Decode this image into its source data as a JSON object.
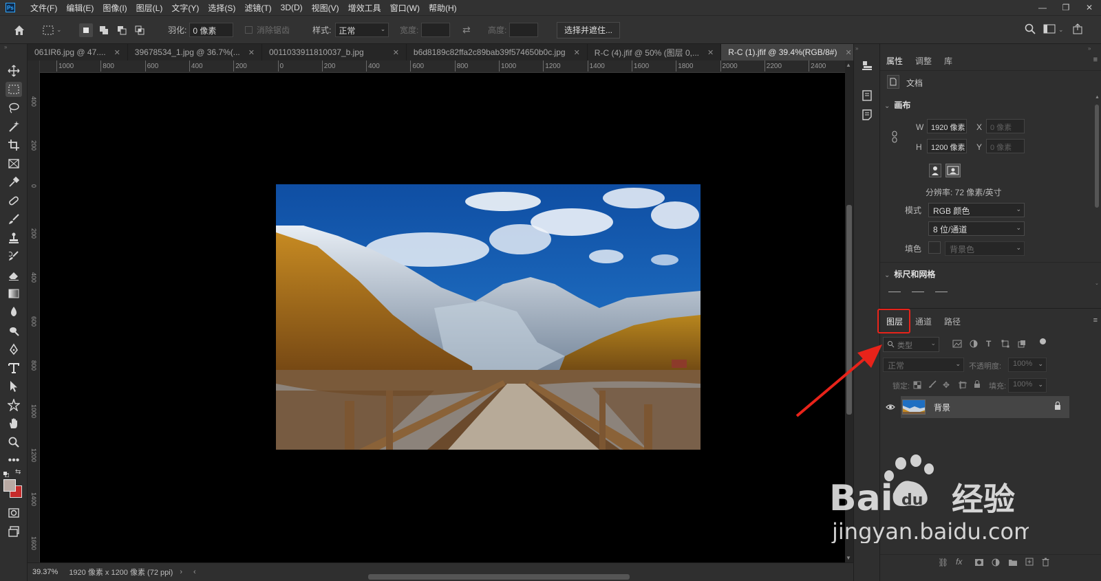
{
  "app": {
    "logo_text": "Ps",
    "menu": [
      "文件(F)",
      "编辑(E)",
      "图像(I)",
      "图层(L)",
      "文字(Y)",
      "选择(S)",
      "滤镜(T)",
      "3D(D)",
      "视图(V)",
      "增效工具",
      "窗口(W)",
      "帮助(H)"
    ]
  },
  "options": {
    "feather_label": "羽化:",
    "feather_value": "0 像素",
    "antialias_label": "消除锯齿",
    "style_label": "样式:",
    "style_value": "正常",
    "width_label": "宽度:",
    "height_label": "高度:",
    "select_mask_button": "选择并遮住..."
  },
  "tabs": [
    {
      "label": "061IR6.jpg @ 47...."
    },
    {
      "label": "39678534_1.jpg @ 36.7%(..."
    },
    {
      "label": "0011033911810037_b.jpg"
    },
    {
      "label": "b6d8189c82ffa2c89bab39f574650b0c.jpg"
    },
    {
      "label": "R-C (4).jfif @ 50% (图层 0,..."
    },
    {
      "label": "R-C (1).jfif @ 39.4%(RGB/8#)"
    }
  ],
  "ruler_top": [
    "1000",
    "800",
    "600",
    "400",
    "200",
    "0",
    "200",
    "400",
    "600",
    "800",
    "1000",
    "1200",
    "1400",
    "1600",
    "1800",
    "2000",
    "2200",
    "2400"
  ],
  "ruler_left": [
    "4 0 0",
    "2 0 0",
    "0",
    "2 0 0",
    "4 0 0",
    "6 0 0",
    "8 0 0",
    "1 0 0 0",
    "1 2 0 0",
    "1 4 0 0",
    "1 6 0 0"
  ],
  "status": {
    "zoom": "39.37%",
    "doc_info": "1920 像素 x 1200 像素 (72 ppi)"
  },
  "properties": {
    "tabs": [
      "属性",
      "调整",
      "库"
    ],
    "doc_label": "文档",
    "canvas_title": "画布",
    "w_label": "W",
    "w_value": "1920 像素",
    "h_label": "H",
    "h_value": "1200 像素",
    "x_label": "X",
    "x_value": "0 像素",
    "y_label": "Y",
    "y_value": "0 像素",
    "resolution": "分辨率: 72 像素/英寸",
    "mode_label": "模式",
    "mode_value": "RGB 颜色",
    "depth_value": "8 位/通道",
    "fill_label": "填色",
    "fill_value": "背景色",
    "rulers_title": "标尺和网格"
  },
  "layers": {
    "tabs": [
      "图层",
      "通道",
      "路径"
    ],
    "filter_label": "类型",
    "blend_mode": "正常",
    "opacity_label": "不透明度:",
    "opacity_value": "100%",
    "lock_label": "锁定:",
    "fill_label": "填充:",
    "fill_value": "100%",
    "items": [
      {
        "name": "背景"
      }
    ]
  },
  "watermark": {
    "brand": "Bai",
    "brand2": "du",
    "brand_cn": "经验",
    "url": "jingyan.baidu.com"
  },
  "colors": {
    "accent_red": "#e8231a",
    "sky": "#1b5fb0",
    "foreground_swatch": "#b9a9a3",
    "background_swatch": "#c62a2a"
  }
}
